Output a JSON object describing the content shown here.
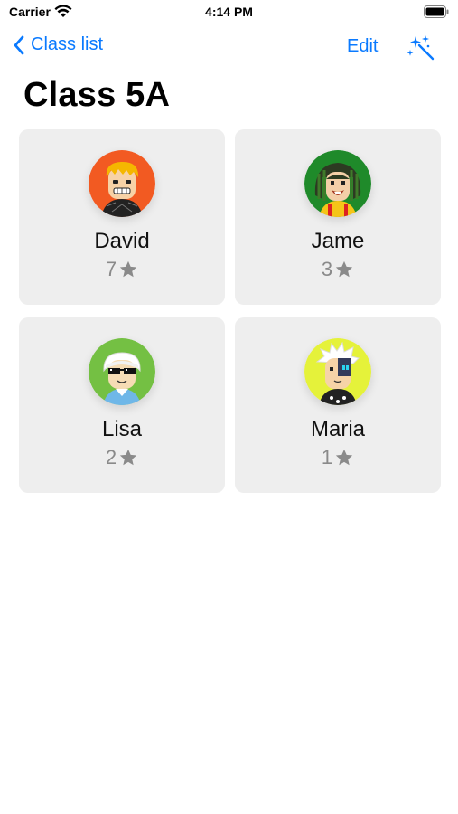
{
  "status_bar": {
    "carrier": "Carrier",
    "time": "4:14 PM"
  },
  "nav": {
    "back_label": "Class list",
    "edit_label": "Edit"
  },
  "page": {
    "title": "Class 5A"
  },
  "students": [
    {
      "name": "David",
      "stars": "7",
      "avatar_color": "#f25a22"
    },
    {
      "name": "Jame",
      "stars": "3",
      "avatar_color": "#1f8a2a"
    },
    {
      "name": "Lisa",
      "stars": "2",
      "avatar_color": "#74c043"
    },
    {
      "name": "Maria",
      "stars": "1",
      "avatar_color": "#e5f23a"
    }
  ],
  "colors": {
    "accent": "#0a7aff",
    "card_bg": "#eeeeee",
    "star": "#8a8a8a"
  },
  "icons": {
    "back": "chevron-left-icon",
    "magic": "sparkles-icon",
    "star": "star-icon",
    "wifi": "wifi-icon",
    "battery": "battery-icon"
  }
}
